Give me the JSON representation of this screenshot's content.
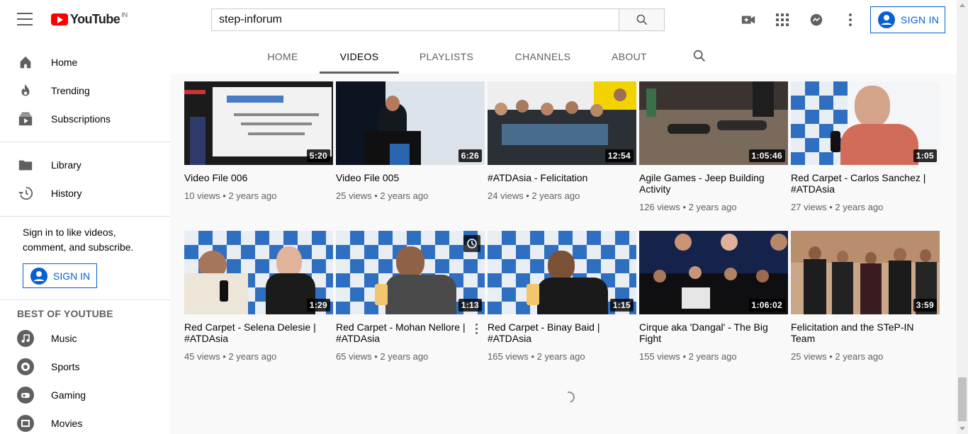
{
  "header": {
    "logo_text": "YouTube",
    "country_code": "IN",
    "search_value": "step-inforum",
    "signin_label": "SIGN IN",
    "icons": [
      "menu-icon",
      "search-icon",
      "create-video-icon",
      "apps-icon",
      "messages-icon",
      "more-icon"
    ]
  },
  "sidebar": {
    "main": [
      {
        "label": "Home",
        "icon": "home-icon"
      },
      {
        "label": "Trending",
        "icon": "flame-icon"
      },
      {
        "label": "Subscriptions",
        "icon": "subscriptions-icon"
      }
    ],
    "library": [
      {
        "label": "Library",
        "icon": "folder-icon"
      },
      {
        "label": "History",
        "icon": "history-icon"
      }
    ],
    "sign_in_text": "Sign in to like videos, comment, and subscribe.",
    "sign_in_button": "SIGN IN",
    "best_title": "BEST OF YOUTUBE",
    "best": [
      {
        "label": "Music",
        "icon": "music-icon"
      },
      {
        "label": "Sports",
        "icon": "sports-icon"
      },
      {
        "label": "Gaming",
        "icon": "gaming-icon"
      },
      {
        "label": "Movies",
        "icon": "movies-icon"
      }
    ]
  },
  "tabs": {
    "items": [
      "HOME",
      "VIDEOS",
      "PLAYLISTS",
      "CHANNELS",
      "ABOUT"
    ],
    "active": "VIDEOS"
  },
  "videos": [
    {
      "title": "Video File 006",
      "views": "10 views",
      "age": "2 years ago",
      "duration": "5:20"
    },
    {
      "title": "Video File 005",
      "views": "25 views",
      "age": "2 years ago",
      "duration": "6:26"
    },
    {
      "title": "#ATDAsia - Felicitation",
      "views": "24 views",
      "age": "2 years ago",
      "duration": "12:54"
    },
    {
      "title": "Agile Games - Jeep Building Activity",
      "views": "126 views",
      "age": "2 years ago",
      "duration": "1:05:46"
    },
    {
      "title": "Red Carpet - Carlos Sanchez | #ATDAsia",
      "views": "27 views",
      "age": "2 years ago",
      "duration": "1:05"
    },
    {
      "title": "Red Carpet - Selena Delesie | #ATDAsia",
      "views": "45 views",
      "age": "2 years ago",
      "duration": "1:29"
    },
    {
      "title": "Red Carpet - Mohan Nellore | #ATDAsia",
      "views": "65 views",
      "age": "2 years ago",
      "duration": "1:13"
    },
    {
      "title": "Red Carpet - Binay Baid | #ATDAsia",
      "views": "165 views",
      "age": "2 years ago",
      "duration": "1:15"
    },
    {
      "title": "Cirque aka 'Dangal' - The Big Fight",
      "views": "155 views",
      "age": "2 years ago",
      "duration": "1:06:02"
    },
    {
      "title": "Felicitation and the STeP-IN Team",
      "views": "25 views",
      "age": "2 years ago",
      "duration": "3:59"
    }
  ],
  "separator": "•",
  "colors": {
    "brand_red": "#ff0000",
    "link_blue": "#065fd4",
    "text_secondary": "#606060"
  }
}
